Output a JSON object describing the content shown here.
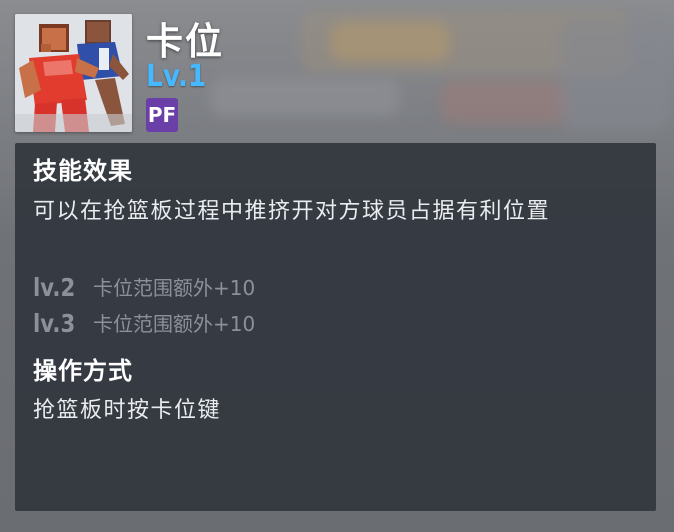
{
  "skill": {
    "name": "卡位",
    "level": "Lv.1",
    "position": "PF",
    "icon": "basketball-player-boxout-icon"
  },
  "effect": {
    "title": "技能效果",
    "description": "可以在抢篮板过程中推挤开对方球员占据有利位置",
    "upgrades": [
      {
        "level": "lv.2",
        "text": "卡位范围额外+10"
      },
      {
        "level": "lv.3",
        "text": "卡位范围额外+10"
      }
    ]
  },
  "operation": {
    "title": "操作方式",
    "description": "抢篮板时按卡位键"
  },
  "colors": {
    "level_accent": "#45b8ff",
    "position_badge": "#6a3fa7",
    "panel": "#34383f"
  }
}
